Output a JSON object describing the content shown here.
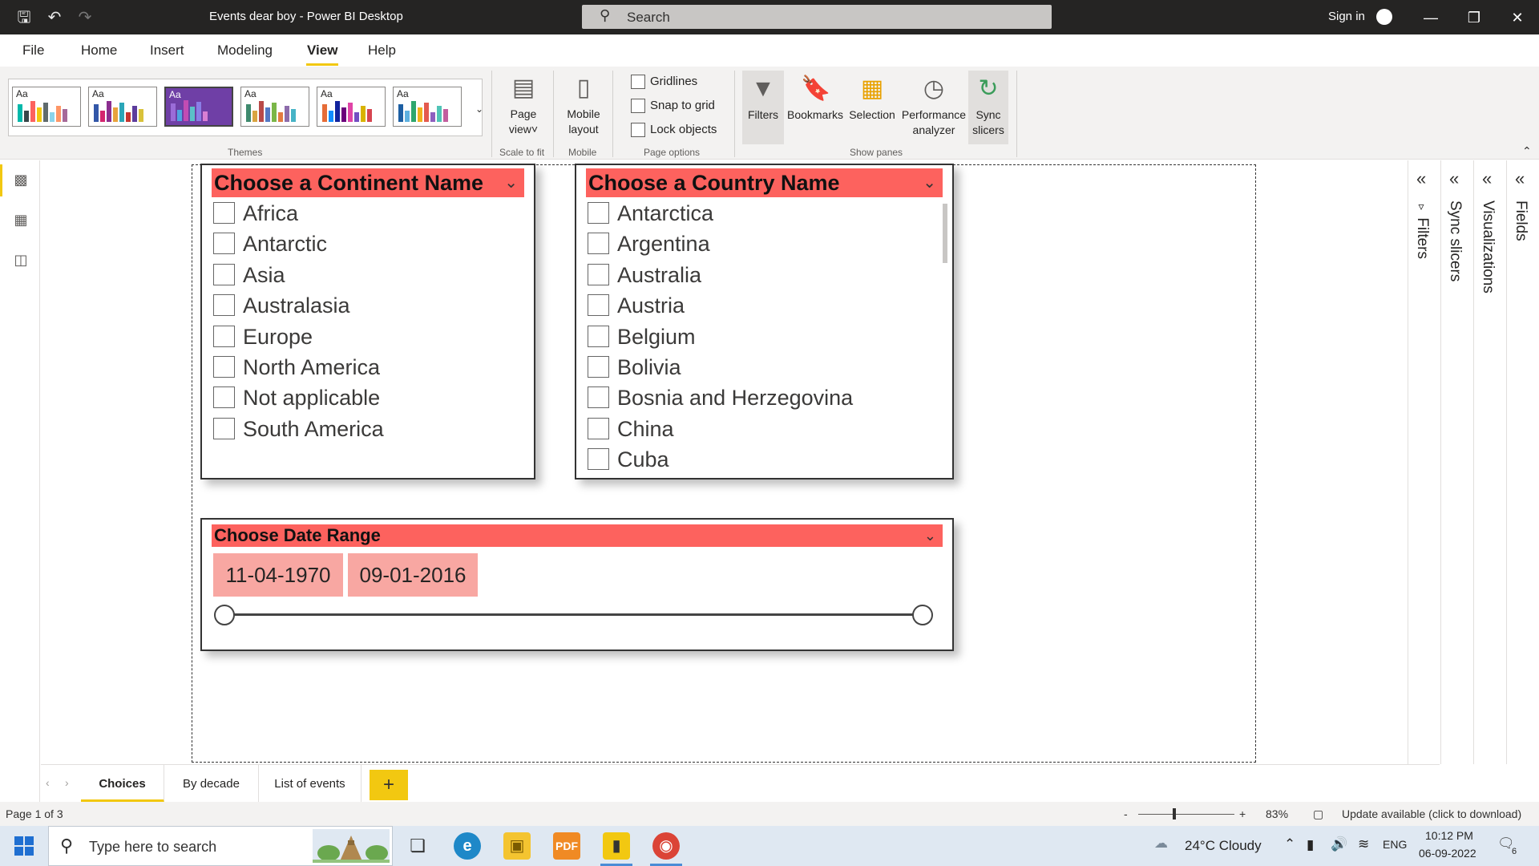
{
  "window": {
    "title": "Events dear boy - Power BI Desktop",
    "search_placeholder": "Search",
    "sign_in": "Sign in"
  },
  "menu": {
    "items": [
      "File",
      "Home",
      "Insert",
      "Modeling",
      "View",
      "Help"
    ],
    "active": "View"
  },
  "ribbon": {
    "groups": {
      "themes": "Themes",
      "scale_to_fit": "Scale to fit",
      "mobile": "Mobile",
      "page_options": "Page options",
      "show_panes": "Show panes"
    },
    "page_view": "Page view",
    "mobile_layout": "Mobile layout",
    "checkboxes": [
      "Gridlines",
      "Snap to grid",
      "Lock objects"
    ],
    "panes": [
      "Filters",
      "Bookmarks",
      "Selection",
      "Performance analyzer",
      "Sync slicers"
    ],
    "theme_swatch_text": "Aa"
  },
  "slicers": {
    "continent": {
      "title": "Choose a Continent Name",
      "options": [
        "Africa",
        "Antarctic",
        "Asia",
        "Australasia",
        "Europe",
        "North America",
        "Not applicable",
        "South America"
      ]
    },
    "country": {
      "title": "Choose a Country Name",
      "options": [
        "Antarctica",
        "Argentina",
        "Australia",
        "Austria",
        "Belgium",
        "Bolivia",
        "Bosnia and Herzegovina",
        "China",
        "Cuba"
      ]
    },
    "date": {
      "title": "Choose Date Range",
      "start": "11-04-1970",
      "end": "09-01-2016"
    }
  },
  "right_panes": [
    "Filters",
    "Sync slicers",
    "Visualizations",
    "Fields"
  ],
  "tabs": [
    "Choices",
    "By decade",
    "List of events"
  ],
  "tabs_add": "+",
  "statusbar": {
    "page": "Page 1 of 3",
    "zoom": "83%",
    "update": "Update available (click to download)",
    "zoom_minus": "-",
    "zoom_plus": "+"
  },
  "taskbar": {
    "search_placeholder": "Type here to search",
    "weather": "24°C  Cloudy",
    "lang": "ENG",
    "time": "10:12 PM",
    "date": "06-09-2022",
    "notifications": "6"
  },
  "colors": {
    "accent": "#f2c811",
    "slicer_header": "#fd625e",
    "date_box": "#f8a7a2"
  }
}
